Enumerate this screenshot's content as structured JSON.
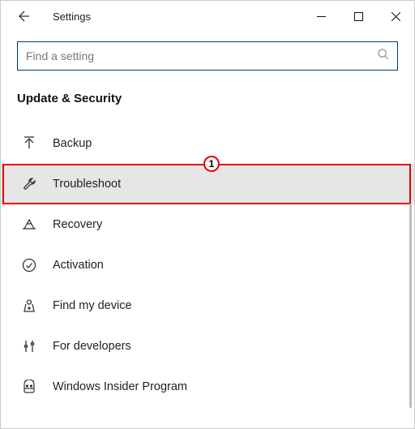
{
  "titlebar": {
    "title": "Settings"
  },
  "search": {
    "placeholder": "Find a setting"
  },
  "section": {
    "title": "Update & Security"
  },
  "nav": {
    "items": [
      {
        "label": "Backup",
        "icon": "backup-arrow-icon",
        "selected": false
      },
      {
        "label": "Troubleshoot",
        "icon": "wrench-icon",
        "selected": true
      },
      {
        "label": "Recovery",
        "icon": "recovery-icon",
        "selected": false
      },
      {
        "label": "Activation",
        "icon": "check-circle-icon",
        "selected": false
      },
      {
        "label": "Find my device",
        "icon": "find-device-icon",
        "selected": false
      },
      {
        "label": "For developers",
        "icon": "developer-tools-icon",
        "selected": false
      },
      {
        "label": "Windows Insider Program",
        "icon": "windows-insider-icon",
        "selected": false
      }
    ]
  },
  "annotation": {
    "badge": "1"
  }
}
